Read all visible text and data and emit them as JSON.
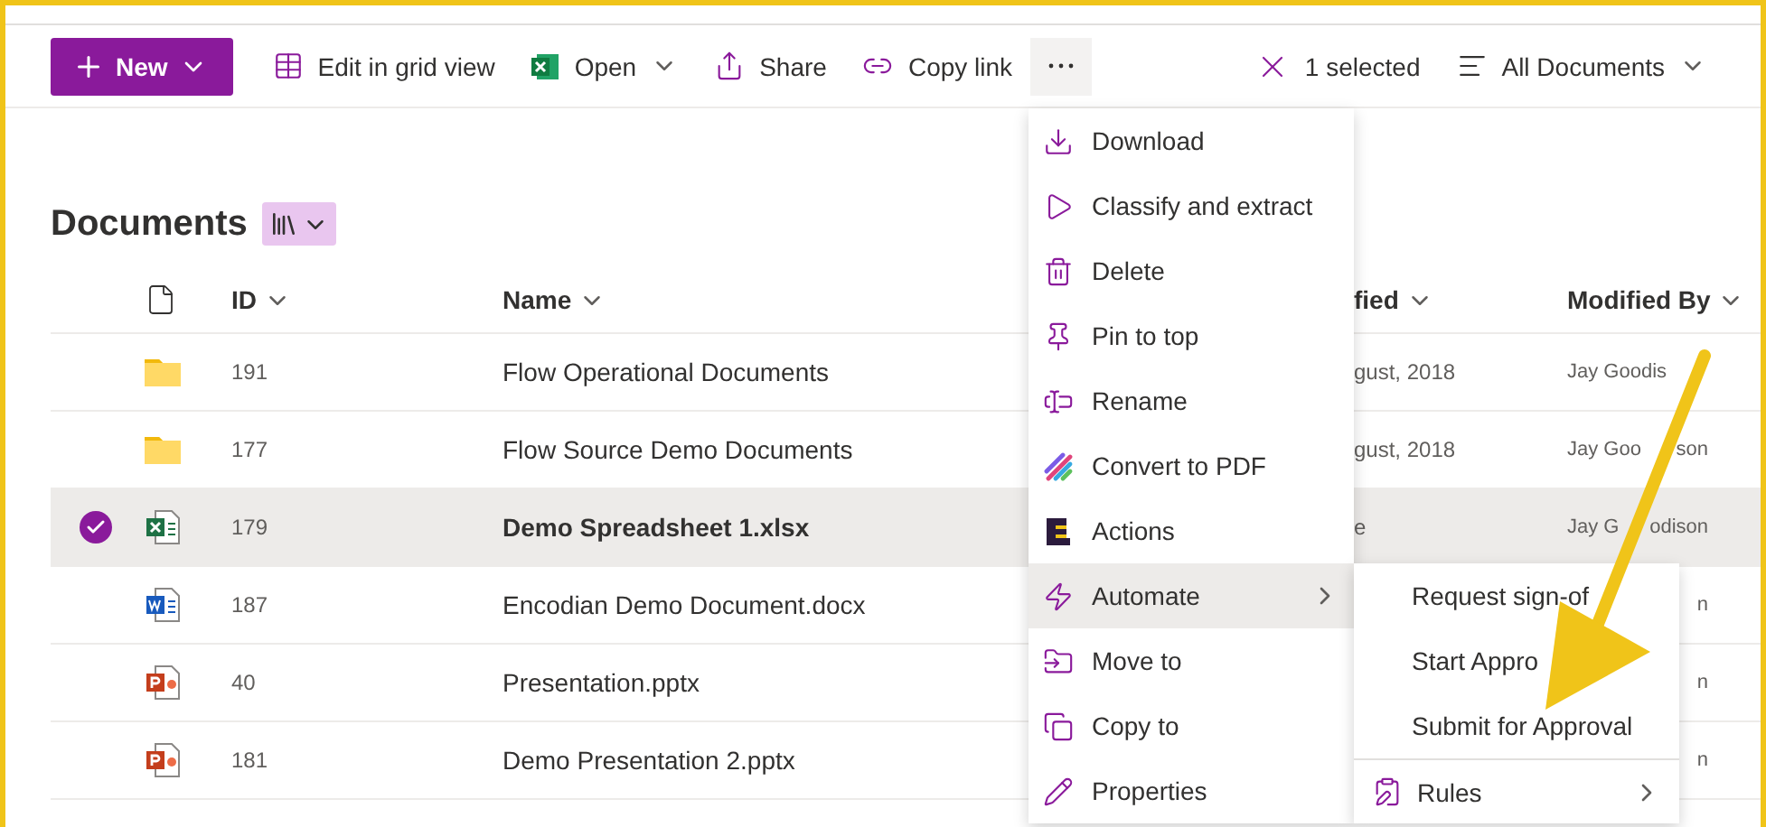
{
  "toolbar": {
    "new_label": "New",
    "items": [
      {
        "kind": "grid",
        "label": "Edit in grid view",
        "dropdown": false
      },
      {
        "kind": "excel",
        "label": "Open",
        "dropdown": true
      },
      {
        "kind": "share",
        "label": "Share",
        "dropdown": false
      },
      {
        "kind": "link",
        "label": "Copy link",
        "dropdown": false
      }
    ],
    "more_active": true,
    "selection": "1 selected",
    "view": "All Documents"
  },
  "title": "Documents",
  "columns": {
    "id": "ID",
    "name": "Name",
    "modified": "fied",
    "modified_by": "Modified By"
  },
  "rows": [
    {
      "kind": "folder",
      "id": "191",
      "name": "Flow Operational Documents",
      "selected": false,
      "modified": "gust, 2018",
      "modified_by": {
        "left": "Jay Goodis"
      }
    },
    {
      "kind": "folder",
      "id": "177",
      "name": "Flow Source Demo Documents",
      "selected": false,
      "modified": "gust, 2018",
      "modified_by": {
        "left": "Jay Goo",
        "right": "son"
      }
    },
    {
      "kind": "excel",
      "id": "179",
      "name": "Demo Spreadsheet 1.xlsx",
      "selected": true,
      "modified": "e",
      "modified_by": {
        "left": "Jay G",
        "right": "odison"
      }
    },
    {
      "kind": "word",
      "id": "187",
      "name": "Encodian Demo Document.docx",
      "selected": false,
      "modified_by": {
        "right": "n"
      }
    },
    {
      "kind": "powerpoint",
      "id": "40",
      "name": "Presentation.pptx",
      "selected": false,
      "modified_by": {
        "right": "n"
      }
    },
    {
      "kind": "powerpoint",
      "id": "181",
      "name": "Demo Presentation 2.pptx",
      "selected": false,
      "modified_by": {
        "right": "n"
      }
    }
  ],
  "menu": [
    {
      "kind": "download",
      "label": "Download",
      "highlighted": false,
      "submenu": false
    },
    {
      "kind": "classify",
      "label": "Classify and extract",
      "highlighted": false,
      "submenu": false
    },
    {
      "kind": "delete",
      "label": "Delete",
      "highlighted": false,
      "submenu": false
    },
    {
      "kind": "pin",
      "label": "Pin to top",
      "highlighted": false,
      "submenu": false
    },
    {
      "kind": "rename",
      "label": "Rename",
      "highlighted": false,
      "submenu": false
    },
    {
      "kind": "convert",
      "label": "Convert to PDF",
      "highlighted": false,
      "submenu": false
    },
    {
      "kind": "actions",
      "label": "Actions",
      "highlighted": false,
      "submenu": false
    },
    {
      "kind": "automate",
      "label": "Automate",
      "highlighted": true,
      "submenu": true
    },
    {
      "kind": "move",
      "label": "Move to",
      "highlighted": false,
      "submenu": false
    },
    {
      "kind": "copy",
      "label": "Copy to",
      "highlighted": false,
      "submenu": false
    },
    {
      "kind": "properties",
      "label": "Properties",
      "highlighted": false,
      "submenu": false
    }
  ],
  "submenu": [
    {
      "kind": "text",
      "label": "Request sign-of"
    },
    {
      "kind": "text",
      "label": "Start Appro"
    },
    {
      "kind": "text",
      "label": "Submit for Approval"
    },
    {
      "kind": "rules",
      "label": "Rules"
    }
  ]
}
